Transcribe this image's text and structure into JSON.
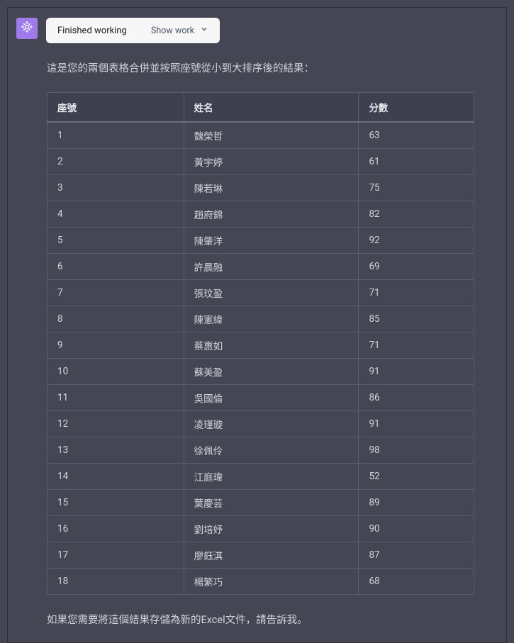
{
  "header": {
    "status_label": "Finished working",
    "show_work_label": "Show work"
  },
  "intro_text": "這是您的兩個表格合併並按照座號從小到大排序後的結果：",
  "outro_text": "如果您需要將這個結果存儲為新的Excel文件，請告訴我。",
  "table": {
    "headers": [
      "座號",
      "姓名",
      "分數"
    ],
    "rows": [
      [
        "1",
        "魏榮哲",
        "63"
      ],
      [
        "2",
        "黃宇婷",
        "61"
      ],
      [
        "3",
        "陳若琳",
        "75"
      ],
      [
        "4",
        "趙府錦",
        "82"
      ],
      [
        "5",
        "陳肇洋",
        "92"
      ],
      [
        "6",
        "許晨融",
        "69"
      ],
      [
        "7",
        "張玟盈",
        "71"
      ],
      [
        "8",
        "陳憲緯",
        "85"
      ],
      [
        "9",
        "蔡惠如",
        "71"
      ],
      [
        "10",
        "蘇美盈",
        "91"
      ],
      [
        "11",
        "吳國倫",
        "86"
      ],
      [
        "12",
        "凌瑾璇",
        "91"
      ],
      [
        "13",
        "徐佩伶",
        "98"
      ],
      [
        "14",
        "江庭瑋",
        "52"
      ],
      [
        "15",
        "葉慶芸",
        "89"
      ],
      [
        "16",
        "劉培妤",
        "90"
      ],
      [
        "17",
        "廖鈺淇",
        "87"
      ],
      [
        "18",
        "楊繁巧",
        "68"
      ]
    ]
  }
}
